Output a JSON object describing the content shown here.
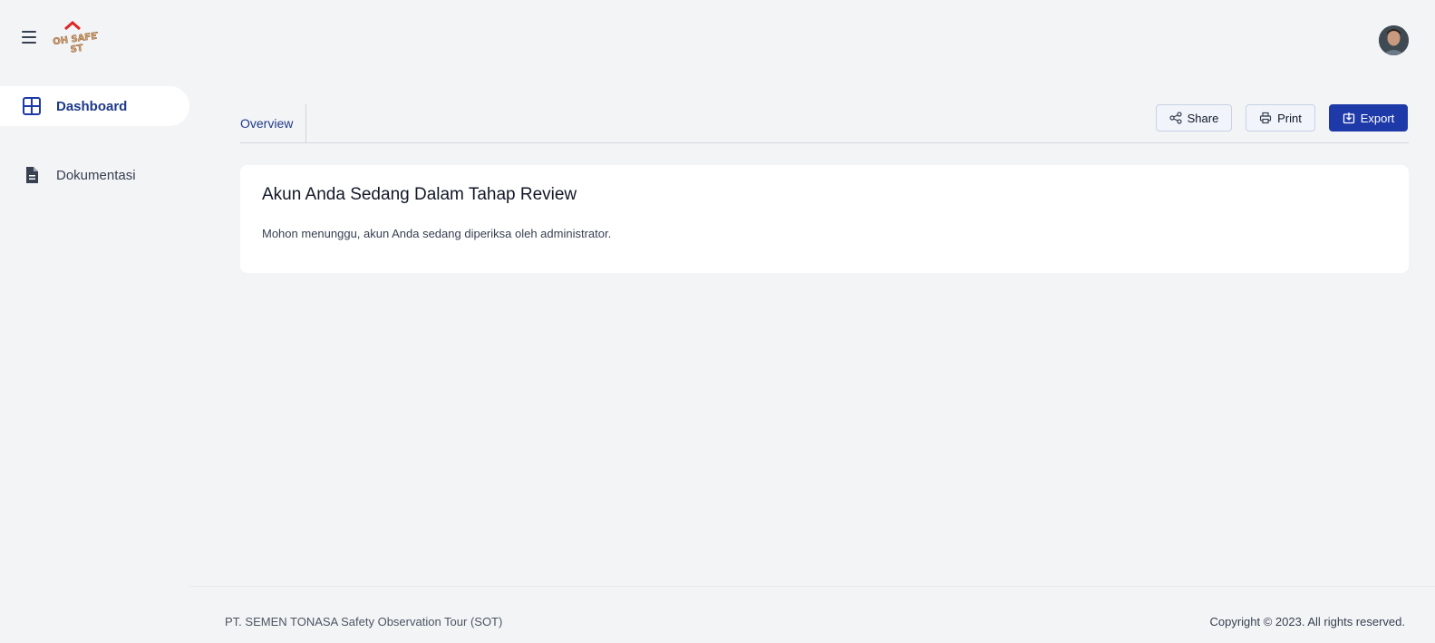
{
  "header": {
    "logo_text_top": "OH SAFETY",
    "logo_text_bottom": "ST",
    "icons": {
      "menu": "hamburger-icon",
      "avatar": "user-avatar"
    }
  },
  "sidebar": {
    "items": [
      {
        "label": "Dashboard",
        "icon": "grid-icon",
        "active": true
      },
      {
        "label": "Dokumentasi",
        "icon": "document-icon",
        "active": false
      }
    ]
  },
  "tabs": {
    "overview": "Overview"
  },
  "actions": {
    "share": "Share",
    "print": "Print",
    "export": "Export"
  },
  "card": {
    "title": "Akun Anda Sedang Dalam Tahap Review",
    "text": "Mohon menunggu, akun Anda sedang diperiksa oleh administrator."
  },
  "footer": {
    "left": "PT. SEMEN TONASA Safety Observation Tour (SOT)",
    "right": "Copyright © 2023. All rights reserved."
  },
  "colors": {
    "accent": "#1e3aa8",
    "background": "#f3f4f6",
    "logo_red": "#dc2626",
    "logo_tan": "#d4a373"
  }
}
